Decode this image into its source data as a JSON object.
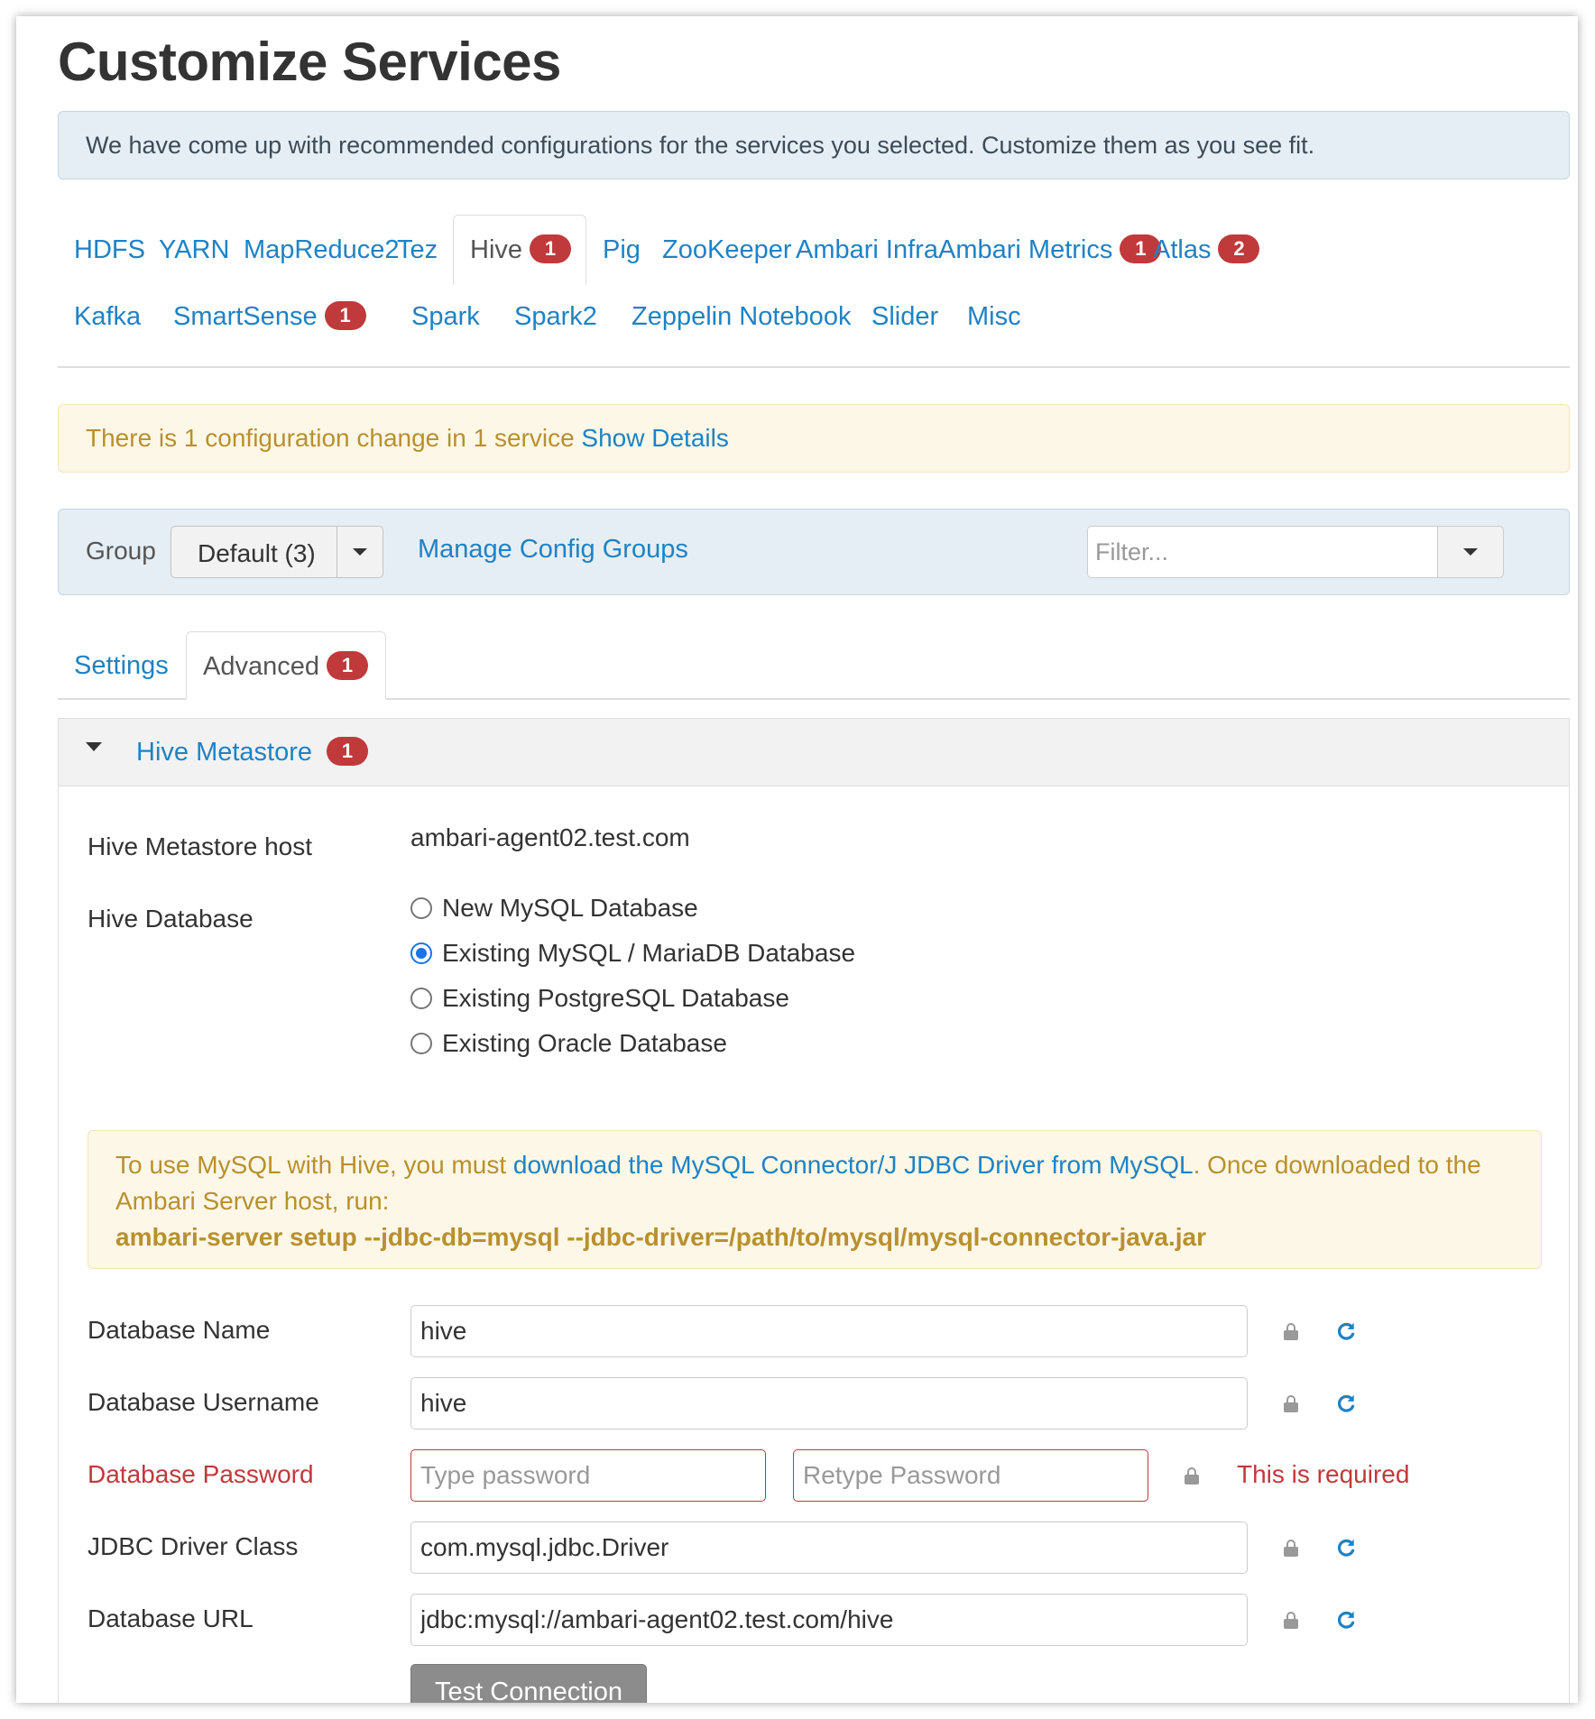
{
  "page": {
    "title": "Customize Services"
  },
  "info_alert": "We have come up with recommended configurations for the services you selected. Customize them as you see fit.",
  "service_tabs": [
    {
      "label": "HDFS",
      "badge": null,
      "active": false
    },
    {
      "label": "YARN",
      "badge": null,
      "active": false
    },
    {
      "label": "MapReduce2",
      "badge": null,
      "active": false
    },
    {
      "label": "Tez",
      "badge": null,
      "active": false
    },
    {
      "label": "Hive",
      "badge": "1",
      "active": true
    },
    {
      "label": "Pig",
      "badge": null,
      "active": false
    },
    {
      "label": "ZooKeeper",
      "badge": null,
      "active": false
    },
    {
      "label": "Ambari Infra",
      "badge": null,
      "active": false
    },
    {
      "label": "Ambari Metrics",
      "badge": "1",
      "active": false
    },
    {
      "label": "Atlas",
      "badge": "2",
      "active": false
    },
    {
      "label": "Kafka",
      "badge": null,
      "active": false
    },
    {
      "label": "SmartSense",
      "badge": "1",
      "active": false
    },
    {
      "label": "Spark",
      "badge": null,
      "active": false
    },
    {
      "label": "Spark2",
      "badge": null,
      "active": false
    },
    {
      "label": "Zeppelin Notebook",
      "badge": null,
      "active": false
    },
    {
      "label": "Slider",
      "badge": null,
      "active": false
    },
    {
      "label": "Misc",
      "badge": null,
      "active": false
    }
  ],
  "warn_alert": {
    "text": "There is 1 configuration change in 1 service",
    "link": "Show Details"
  },
  "group_bar": {
    "label": "Group",
    "selected": "Default (3)",
    "manage_link": "Manage Config Groups",
    "filter_placeholder": "Filter..."
  },
  "sub_tabs": [
    {
      "label": "Settings",
      "badge": null,
      "active": false
    },
    {
      "label": "Advanced",
      "badge": "1",
      "active": true
    }
  ],
  "section": {
    "title": "Hive Metastore",
    "badge": "1",
    "metastore_host_label": "Hive Metastore host",
    "metastore_host_value": "ambari-agent02.test.com",
    "database_label": "Hive Database",
    "database_options": [
      {
        "label": "New MySQL Database",
        "checked": false
      },
      {
        "label": "Existing MySQL / MariaDB Database",
        "checked": true
      },
      {
        "label": "Existing PostgreSQL Database",
        "checked": false
      },
      {
        "label": "Existing Oracle Database",
        "checked": false
      }
    ],
    "mysql_note": {
      "prefix": "To use MySQL with Hive, you must",
      "link": "download the MySQL Connector/J JDBC Driver from MySQL",
      "suffix": ". Once downloaded to the Ambari Server host, run:",
      "command": "ambari-server setup --jdbc-db=mysql --jdbc-driver=/path/to/mysql/mysql-connector-java.jar"
    },
    "fields": {
      "db_name": {
        "label": "Database Name",
        "value": "hive"
      },
      "db_username": {
        "label": "Database Username",
        "value": "hive"
      },
      "db_password": {
        "label": "Database Password",
        "placeholder": "Type password",
        "retype_placeholder": "Retype Password",
        "error": "This is required"
      },
      "jdbc_driver": {
        "label": "JDBC Driver Class",
        "value": "com.mysql.jdbc.Driver"
      },
      "db_url": {
        "label": "Database URL",
        "value": "jdbc:mysql://ambari-agent02.test.com/hive"
      }
    },
    "test_button": "Test Connection"
  },
  "icons": {
    "lock": "lock-icon",
    "refresh": "refresh-icon",
    "caret": "caret-down-icon"
  },
  "colors": {
    "link": "#1f82c4",
    "badge": "#c0393b",
    "error": "#c0393b",
    "warning_text": "#b8902f",
    "info_bg": "#e5eef4",
    "warning_bg": "#fcf7e6",
    "radio_checked": "#1a73e8"
  }
}
